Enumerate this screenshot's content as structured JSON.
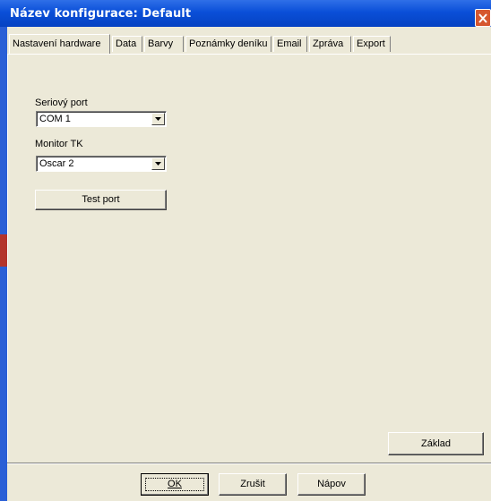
{
  "window": {
    "title": "Název konfigurace: Default"
  },
  "tabs": [
    {
      "label": "Nastavení hardware",
      "active": true
    },
    {
      "label": "Data",
      "active": false
    },
    {
      "label": "Barvy",
      "active": false
    },
    {
      "label": "Poznámky deníku",
      "active": false
    },
    {
      "label": "Email",
      "active": false
    },
    {
      "label": "Zpráva",
      "active": false
    },
    {
      "label": "Export",
      "active": false
    }
  ],
  "hardware": {
    "serial_port_label": "Seriový port",
    "serial_port_value": "COM 1",
    "monitor_label": "Monitor TK",
    "monitor_value": "Oscar 2",
    "test_port_label": "Test port",
    "default_label": "Základ"
  },
  "footer": {
    "ok_label": "OK",
    "cancel_label": "Zrušit",
    "help_label": "Nápov"
  },
  "icons": {
    "close": "close-icon",
    "dropdown": "chevron-down-icon"
  },
  "colors": {
    "titlebar": "#0a4fd8",
    "close": "#d6572f",
    "face": "#ece9d8"
  }
}
